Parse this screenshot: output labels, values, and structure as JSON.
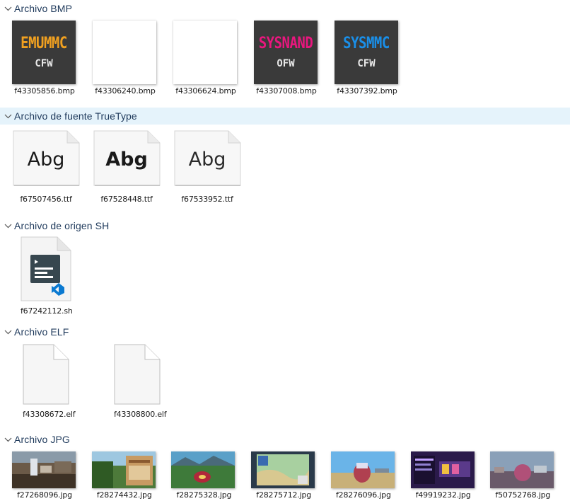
{
  "groups": {
    "bmp": {
      "title": "Archivo BMP",
      "items": [
        {
          "name": "f43305856.bmp",
          "thumb_big": "EMUMMC",
          "thumb_small": "CFW",
          "big_color": "#f0a020"
        },
        {
          "name": "f43306240.bmp"
        },
        {
          "name": "f43306624.bmp"
        },
        {
          "name": "f43307008.bmp",
          "thumb_big": "SYSNAND",
          "thumb_small": "OFW",
          "big_color": "#e8177e"
        },
        {
          "name": "f43307392.bmp",
          "thumb_big": "SYSMMC",
          "thumb_small": "CFW",
          "big_color": "#1a8fe8"
        }
      ]
    },
    "ttf": {
      "title": "Archivo de fuente TrueType",
      "items": [
        {
          "name": "f67507456.ttf",
          "sample": "Abg"
        },
        {
          "name": "f67528448.ttf",
          "sample": "Abg"
        },
        {
          "name": "f67533952.ttf",
          "sample": "Abg"
        }
      ]
    },
    "sh": {
      "title": "Archivo de origen SH",
      "items": [
        {
          "name": "f67242112.sh",
          "icon": "vscode-shell-file-icon"
        }
      ]
    },
    "elf": {
      "title": "Archivo ELF",
      "items": [
        {
          "name": "f43308672.elf",
          "icon": "blank-document-icon"
        },
        {
          "name": "f43308800.elf",
          "icon": "blank-document-icon"
        }
      ]
    },
    "jpg": {
      "title": "Archivo JPG",
      "items": [
        {
          "name": "f27268096.jpg"
        },
        {
          "name": "f28274432.jpg"
        },
        {
          "name": "f28275328.jpg"
        },
        {
          "name": "f28275712.jpg"
        },
        {
          "name": "f28276096.jpg"
        },
        {
          "name": "f49919232.jpg"
        },
        {
          "name": "f50752768.jpg"
        }
      ]
    }
  },
  "colors": {
    "header_text": "#1e395b",
    "header_highlight": "#e5f3fb",
    "vscode_blue": "#0b7ad1",
    "sh_icon_bg": "#37474f"
  }
}
